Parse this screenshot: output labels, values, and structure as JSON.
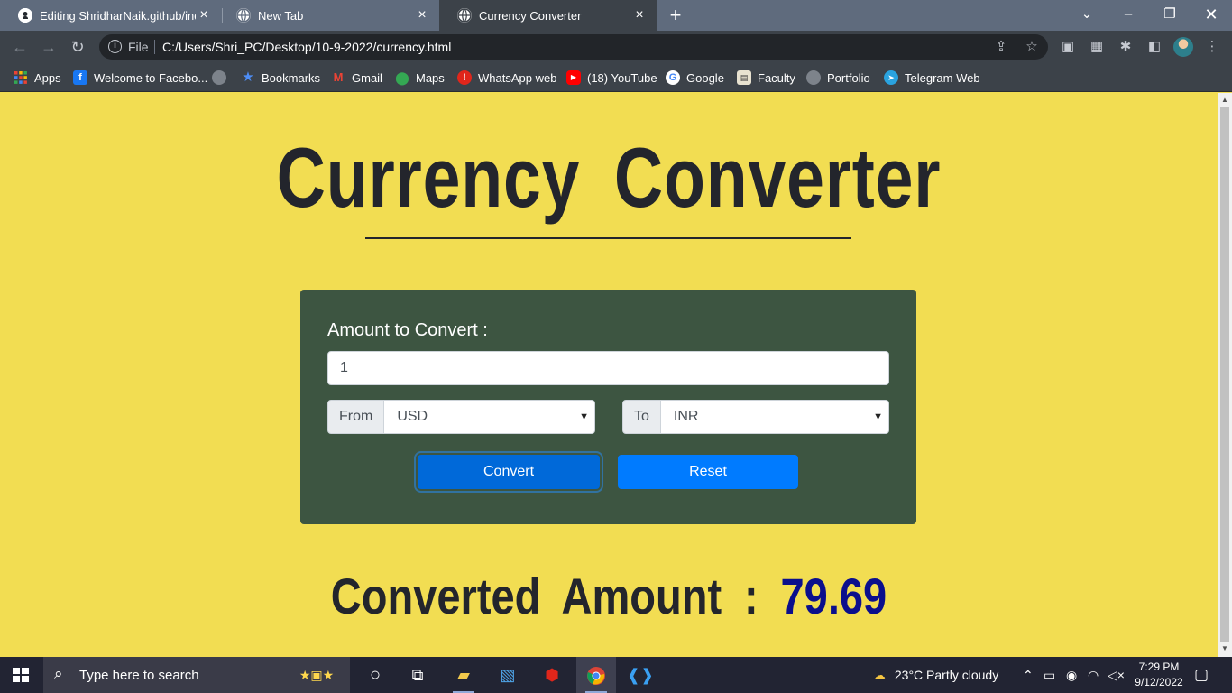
{
  "browser": {
    "tabs": [
      {
        "title": "Editing ShridharNaik.github/inde",
        "icon": "github-icon",
        "active": false
      },
      {
        "title": "New Tab",
        "icon": "globe-icon",
        "active": false
      },
      {
        "title": "Currency Converter",
        "icon": "globe-icon",
        "active": true
      }
    ],
    "new_tab_label": "+",
    "address": {
      "scheme_label": "File",
      "url": "C:/Users/Shri_PC/Desktop/10-9-2022/currency.html"
    },
    "bookmarks": [
      {
        "label": "Apps",
        "icon": "apps-grid-icon"
      },
      {
        "label": "Welcome to Facebo...",
        "icon": "facebook-icon"
      },
      {
        "label": "",
        "icon": "globe-icon"
      },
      {
        "label": "Bookmarks",
        "icon": "star-icon"
      },
      {
        "label": "Gmail",
        "icon": "gmail-icon"
      },
      {
        "label": "Maps",
        "icon": "maps-pin-icon"
      },
      {
        "label": "WhatsApp web",
        "icon": "whatsapp-icon"
      },
      {
        "label": "(18) YouTube",
        "icon": "youtube-icon"
      },
      {
        "label": "Google",
        "icon": "google-icon"
      },
      {
        "label": "Faculty",
        "icon": "faculty-icon"
      },
      {
        "label": "Portfolio",
        "icon": "globe-icon"
      },
      {
        "label": "Telegram Web",
        "icon": "telegram-icon"
      }
    ]
  },
  "page": {
    "title": "Currency Converter",
    "form": {
      "amount_label": "Amount to Convert :",
      "amount_value": "1",
      "from_label": "From",
      "from_value": "USD",
      "to_label": "To",
      "to_value": "INR",
      "convert_label": "Convert",
      "reset_label": "Reset"
    },
    "result": {
      "label": "Converted Amount :",
      "value": "79.69"
    },
    "colors": {
      "background": "#f2dd52",
      "card": "#3d5541",
      "primary": "#007bff",
      "result_value": "#0b0f8c"
    }
  },
  "taskbar": {
    "search_placeholder": "Type here to search",
    "weather": "23°C  Partly cloudy",
    "time": "7:29 PM",
    "date": "9/12/2022"
  }
}
